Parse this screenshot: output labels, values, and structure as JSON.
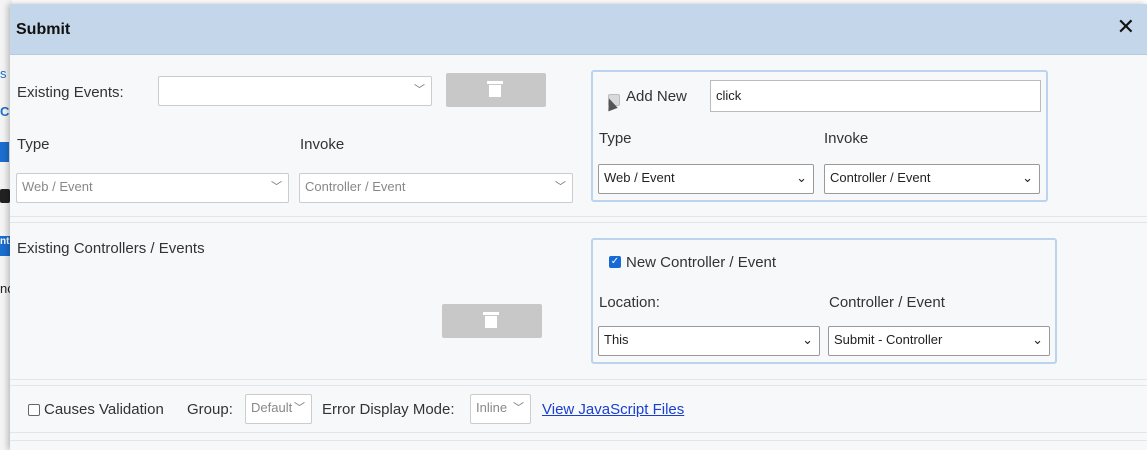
{
  "dialog": {
    "title": "Submit",
    "close_glyph": "✕"
  },
  "background_fragments": [
    "s",
    "Cl",
    "nt",
    "nc"
  ],
  "events": {
    "existing_label": "Existing Events:",
    "existing_value": "",
    "type_label": "Type",
    "invoke_label": "Invoke",
    "type_value": "Web / Event",
    "invoke_value": "Controller / Event",
    "delete_icon": "trash-icon"
  },
  "add_new": {
    "checkbox_label": "Add New",
    "checked": true,
    "disabled": true,
    "name_value": "click",
    "type_label": "Type",
    "invoke_label": "Invoke",
    "type_value": "Web / Event",
    "invoke_value": "Controller / Event"
  },
  "controllers": {
    "existing_label": "Existing Controllers / Events",
    "delete_icon": "trash-icon"
  },
  "new_controller": {
    "checkbox_label": "New Controller / Event",
    "checked": true,
    "location_label": "Location:",
    "controller_label": "Controller / Event",
    "location_value": "This",
    "controller_value": "Submit - Controller"
  },
  "footer": {
    "causes_validation_label": "Causes Validation",
    "causes_validation_checked": false,
    "group_label": "Group:",
    "group_value": "Default",
    "error_mode_label": "Error Display Mode:",
    "error_mode_value": "Inline",
    "js_link": "View JavaScript Files"
  },
  "colors": {
    "titlebar": "#c4d6ea",
    "panel_border": "#bcd3ee",
    "checkbox_accent": "#1769d6",
    "link": "#1a3fd0",
    "delete_button": "#c8c8c8"
  }
}
